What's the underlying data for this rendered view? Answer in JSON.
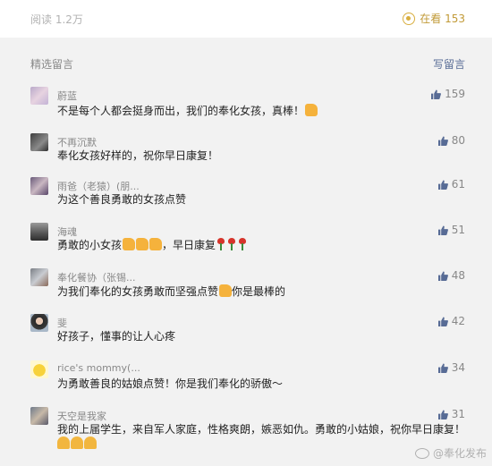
{
  "header": {
    "reads": "阅读 1.2万",
    "watching": "在看 153"
  },
  "section": {
    "title": "精选留言",
    "write_label": "写留言"
  },
  "comments": [
    {
      "nick": "蔚蓝",
      "text": "不是每个人都会挺身而出，我们的奉化女孩，真棒！",
      "likes": "159"
    },
    {
      "nick": "不再沉默",
      "text": "奉化女孩好样的，祝你早日康复！",
      "likes": "80"
    },
    {
      "nick": "雨爸（老猿）(朋...",
      "text": "为这个善良勇敢的女孩点赞",
      "likes": "61"
    },
    {
      "nick": "海魂",
      "text": "勇敢的小女孩",
      "text2": "，早日康复",
      "likes": "51"
    },
    {
      "nick": "奉化餐协（张锡...",
      "text": "为我们奉化的女孩勇敢而坚强点赞",
      "text2": "你是最棒的",
      "likes": "48"
    },
    {
      "nick": "斐",
      "text": "好孩子，懂事的让人心疼",
      "likes": "42"
    },
    {
      "nick": "rice's mommy(...",
      "text": "为勇敢善良的姑娘点赞！你是我们奉化的骄傲～",
      "likes": "34"
    },
    {
      "nick": "天空是我家",
      "text": "我的上届学生，来自军人家庭，性格爽朗，嫉恶如仇。勇敢的小姑娘，祝你早日康复！",
      "likes": "31"
    }
  ],
  "watermark": "@奉化发布",
  "colors": {
    "accent_gold": "#c19a37",
    "link_blue": "#576b95",
    "thumb_blue": "#576b95"
  },
  "icons": {
    "watching": "eye-icon",
    "like": "thumbs-up-icon",
    "emoji_thumb": "thumbs-up-emoji",
    "emoji_rose": "rose-emoji",
    "emoji_pray": "pray-emoji"
  }
}
